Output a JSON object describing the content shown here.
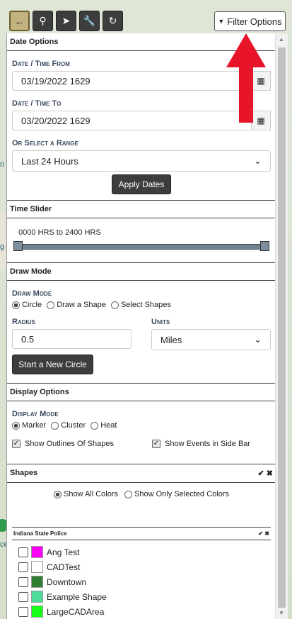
{
  "toolbar": {
    "buttons": [
      "back-arrow-icon",
      "search-icon",
      "location-arrow-icon",
      "wrench-icon",
      "refresh-icon"
    ],
    "filter_label": "Filter Options"
  },
  "date_options": {
    "title": "Date Options",
    "from_label": "Date / Time From",
    "from_value": "03/19/2022 1629",
    "to_label": "Date / Time To",
    "to_value": "03/20/2022 1629",
    "range_label": "Or Select a Range",
    "range_value": "Last 24 Hours",
    "apply_label": "Apply Dates"
  },
  "time_slider": {
    "title": "Time Slider",
    "range_text": "0000 HRS to 2400 HRS"
  },
  "draw_mode": {
    "title": "Draw Mode",
    "mode_label": "Draw Mode",
    "options": [
      "Circle",
      "Draw a Shape",
      "Select Shapes"
    ],
    "radius_label": "Radius",
    "radius_value": "0.5",
    "units_label": "Units",
    "units_value": "Miles",
    "start_label": "Start a New Circle"
  },
  "display_options": {
    "title": "Display Options",
    "mode_label": "Display Mode",
    "modes": [
      "Marker",
      "Cluster",
      "Heat"
    ],
    "outlines_label": "Show Outlines Of Shapes",
    "events_label": "Show Events in Side Bar"
  },
  "shapes": {
    "title": "Shapes",
    "show_all": "Show All Colors",
    "show_selected": "Show Only Selected Colors",
    "group_title": "Indiana State Police",
    "items": [
      {
        "label": "Ang Test",
        "color": "#ff00ff"
      },
      {
        "label": "CADTest",
        "color": "#ffffff"
      },
      {
        "label": "Downtown",
        "color": "#2e7d32"
      },
      {
        "label": "Example Shape",
        "color": "#4ddc9a"
      },
      {
        "label": "LargeCADArea",
        "color": "#1aff1a"
      }
    ]
  },
  "map_labels": {
    "left1": "n",
    "left2": "g",
    "left3": "ce"
  }
}
